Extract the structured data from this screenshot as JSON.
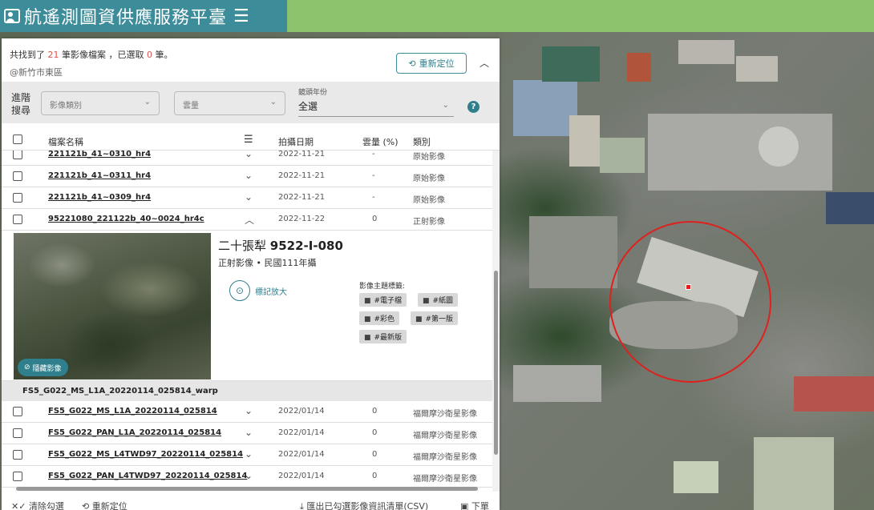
{
  "header": {
    "site_title": "航遙測圖資供應服務平臺",
    "logo_icon": "user-map-icon",
    "menu_icon": "hamburger-icon",
    "bar_color": "#8dc26d",
    "title_color": "#3d8c9a"
  },
  "summary": {
    "prefix": "共找到了",
    "found_count": "21",
    "middle": "筆影像檔案 ，已選取",
    "selected_count": "0",
    "suffix": "筆。",
    "location": "@新竹市東區",
    "relocate_label": "重新定位"
  },
  "advanced": {
    "label_line1": "進階",
    "label_line2": "搜尋",
    "category_placeholder": "影像類別",
    "cloud_placeholder": "雲量",
    "year_caption": "鏡頭年份",
    "year_value": "全選"
  },
  "table": {
    "headers": {
      "name": "檔案名稱",
      "date": "拍攝日期",
      "cloud": "雲量 (%)",
      "type": "類別"
    },
    "rows_top": [
      {
        "name": "221121b_41~0310_hr4",
        "date": "2022-11-21",
        "cloud": "-",
        "type": "原始影像"
      },
      {
        "name": "221121b_41~0311_hr4",
        "date": "2022-11-21",
        "cloud": "-",
        "type": "原始影像"
      },
      {
        "name": "221121b_41~0309_hr4",
        "date": "2022-11-21",
        "cloud": "-",
        "type": "原始影像"
      },
      {
        "name": "95221080_221122b_40~0024_hr4c",
        "date": "2022-11-22",
        "cloud": "0",
        "type": "正射影像"
      }
    ],
    "group_name": "FS5_G022_MS_L1A_20220114_025814_warp",
    "rows_bottom": [
      {
        "name": "FS5_G022_MS_L1A_20220114_025814",
        "date": "2022/01/14",
        "cloud": "0",
        "type": "福爾摩沙衛星影像"
      },
      {
        "name": "FS5_G022_PAN_L1A_20220114_025814",
        "date": "2022/01/14",
        "cloud": "0",
        "type": "福爾摩沙衛星影像"
      },
      {
        "name": "FS5_G022_MS_L4TWD97_20220114_025814",
        "date": "2022/01/14",
        "cloud": "0",
        "type": "福爾摩沙衛星影像"
      },
      {
        "name": "FS5_G022_PAN_L4TWD97_20220114_025814",
        "date": "2022/01/14",
        "cloud": "0",
        "type": "福爾摩沙衛星影像"
      }
    ]
  },
  "detail": {
    "title_prefix": "二十張犁",
    "title_code": "9522-I-080",
    "subtitle": "正射影像 • 民國111年攝",
    "hide_image_label": "隱藏影像",
    "mark_zoom_label": "標記放大",
    "tags_label": "影像主題標籤:",
    "tags": [
      "#電子檔",
      "#紙圖",
      "#彩色",
      "#第一版",
      "#最新版"
    ]
  },
  "footer": {
    "clear_label": "清除勾選",
    "relocate_label": "重新定位",
    "export_label": "匯出已勾選影像資訊清單(CSV)",
    "next_label": "下單"
  },
  "map": {
    "marker_color": "#e0201c"
  }
}
